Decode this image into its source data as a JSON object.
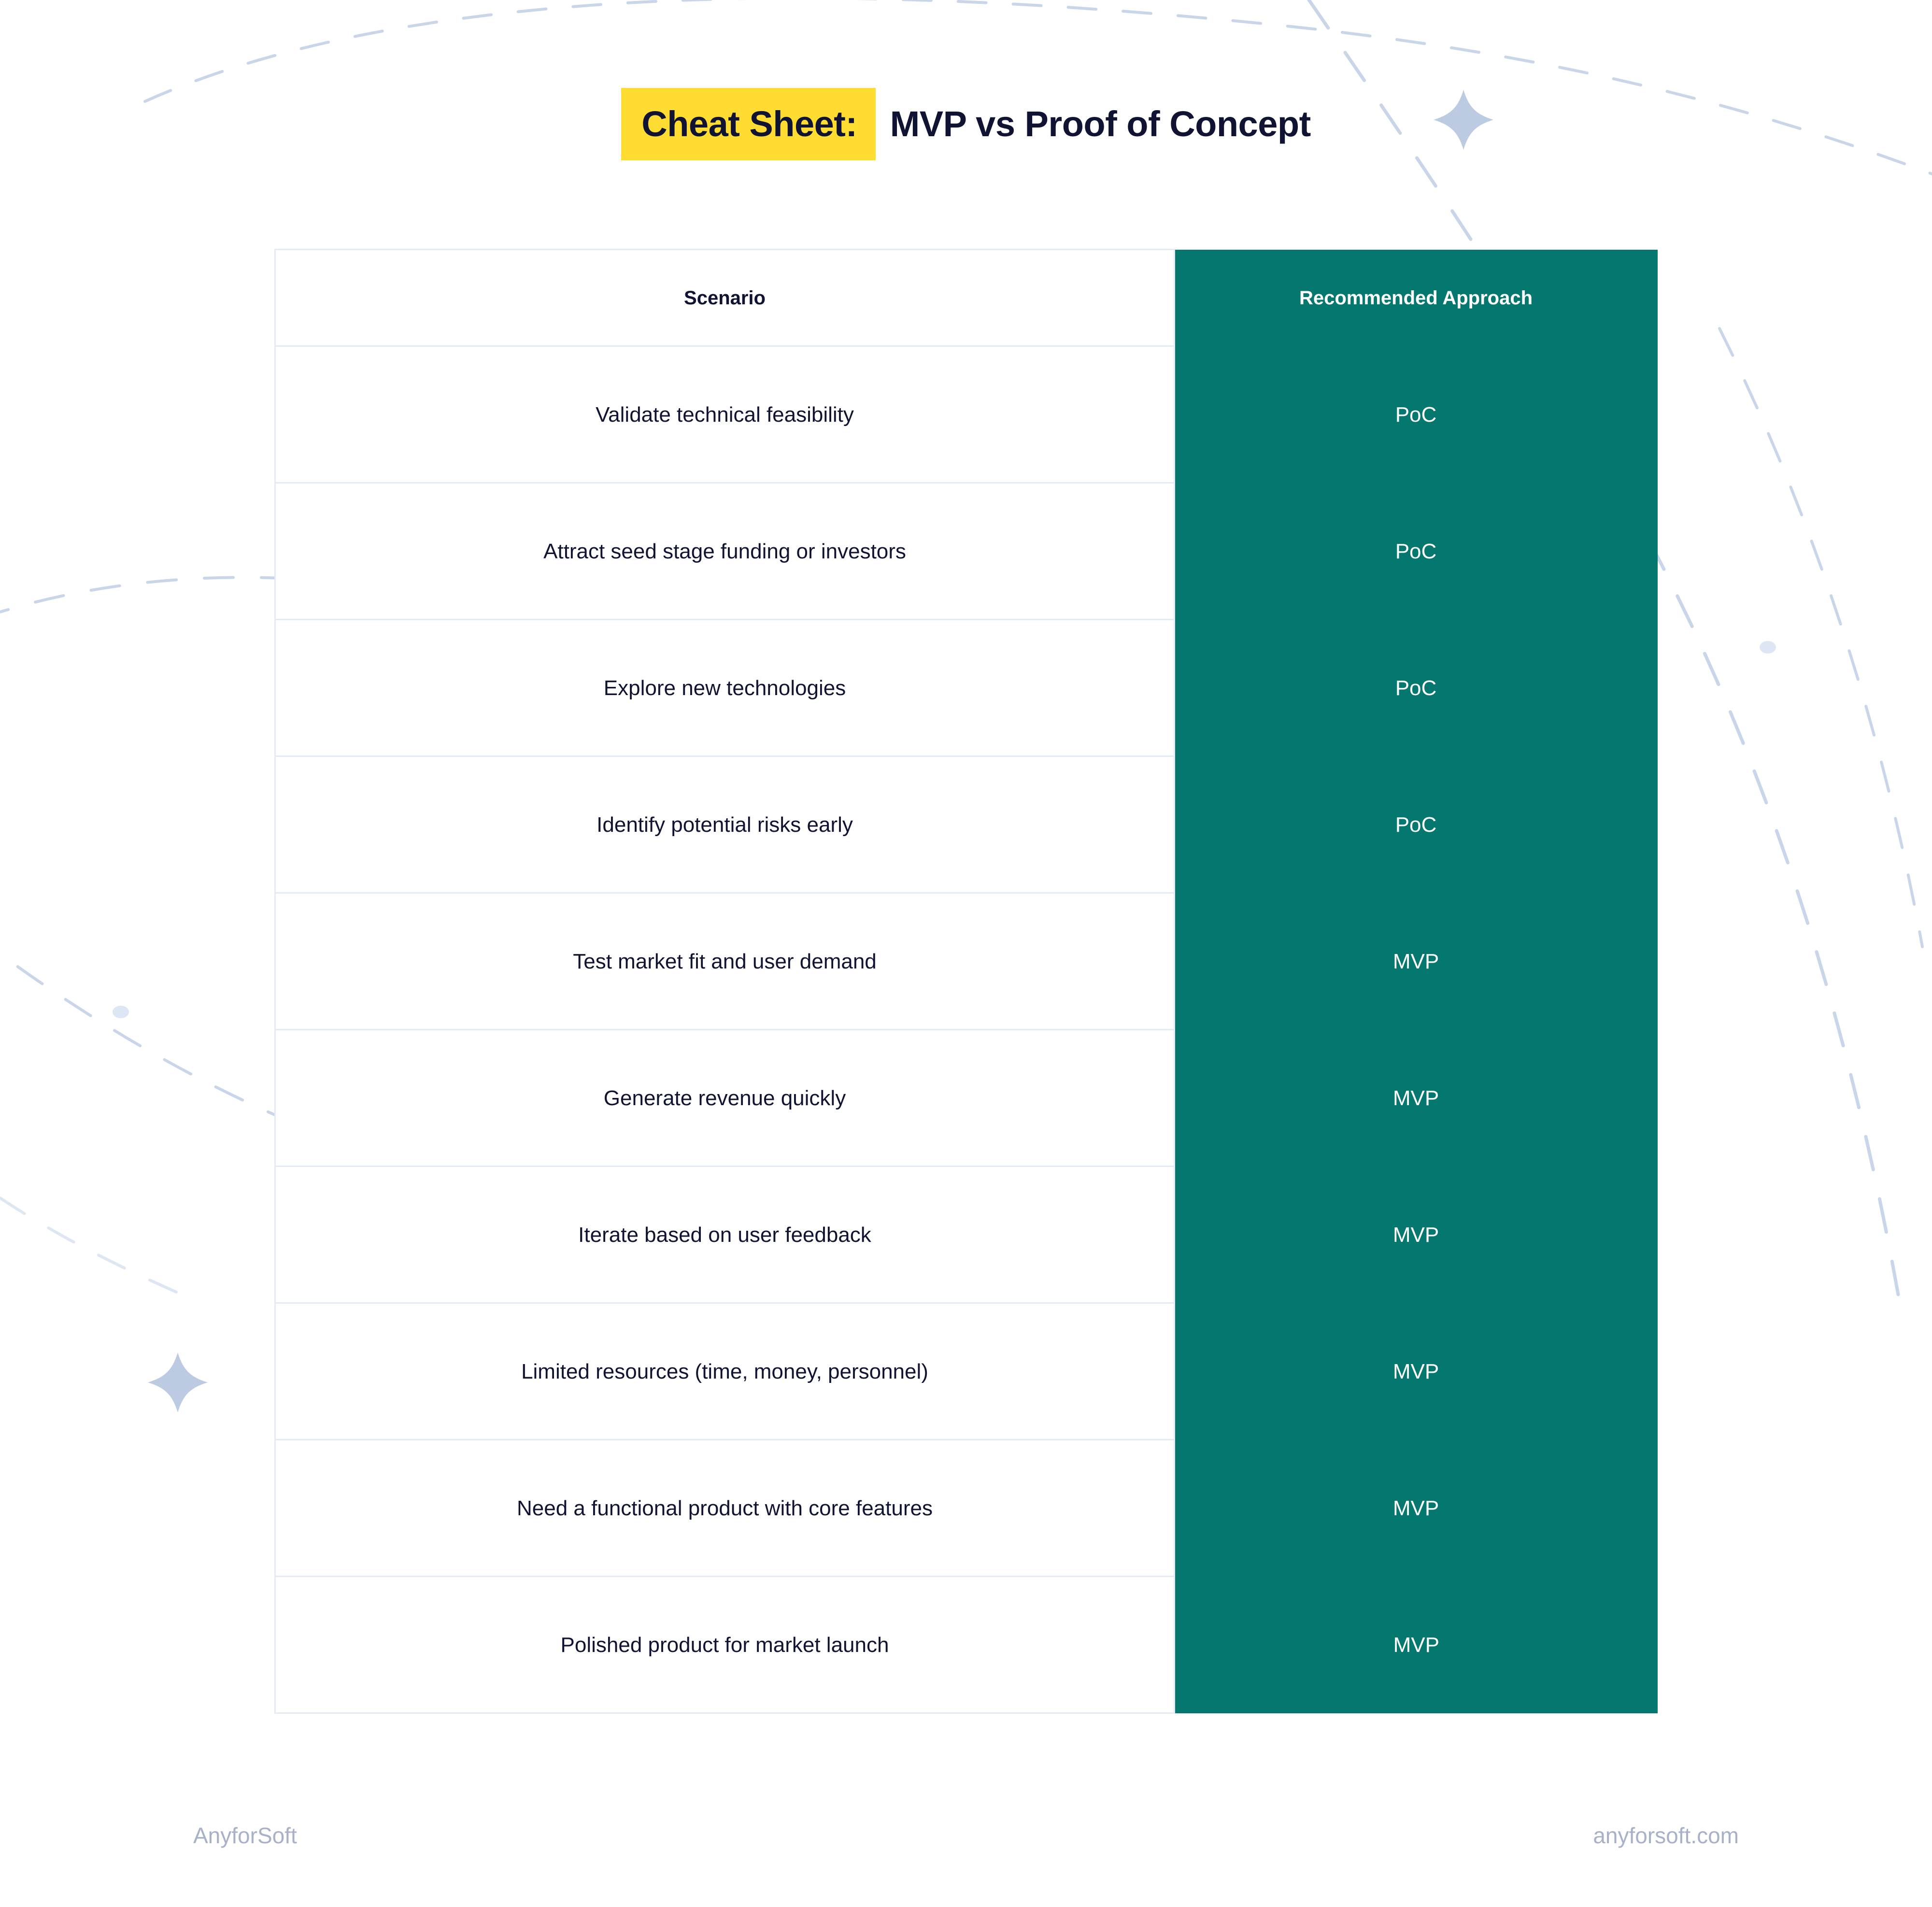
{
  "title": {
    "highlight": "Cheat Sheet:",
    "rest": "MVP vs Proof of Concept",
    "highlight_color": "#FFDC32",
    "text_color": "#101432"
  },
  "table": {
    "columns": [
      {
        "key": "scenario",
        "label": "Scenario"
      },
      {
        "key": "approach",
        "label": "Recommended Approach"
      }
    ],
    "header_accent_color": "#04786E",
    "header_text_color_right": "#FFFFFF",
    "border_color": "#E4EBF6",
    "rows": [
      {
        "scenario": "Validate technical feasibility",
        "approach": "PoC"
      },
      {
        "scenario": "Attract seed stage funding or investors",
        "approach": "PoC"
      },
      {
        "scenario": "Explore new technologies",
        "approach": "PoC"
      },
      {
        "scenario": "Identify potential risks early",
        "approach": "PoC"
      },
      {
        "scenario": "Test market fit and user demand",
        "approach": "MVP"
      },
      {
        "scenario": "Generate revenue quickly",
        "approach": "MVP"
      },
      {
        "scenario": "Iterate based on user feedback",
        "approach": "MVP"
      },
      {
        "scenario": "Limited resources (time, money, personnel)",
        "approach": "MVP"
      },
      {
        "scenario": "Need a functional product with core features",
        "approach": "MVP"
      },
      {
        "scenario": "Polished product for market launch",
        "approach": "MVP"
      }
    ]
  },
  "footer": {
    "brand": "AnyforSoft",
    "website": "anyforsoft.com",
    "text_color": "#A8B1C8"
  },
  "decorations": {
    "line_color": "#C9D6EA",
    "shape_color": "#BCCBE2",
    "dot_color": "#DCE6F5",
    "star_top_right": "star-icon",
    "star_bottom_left": "star-icon"
  }
}
